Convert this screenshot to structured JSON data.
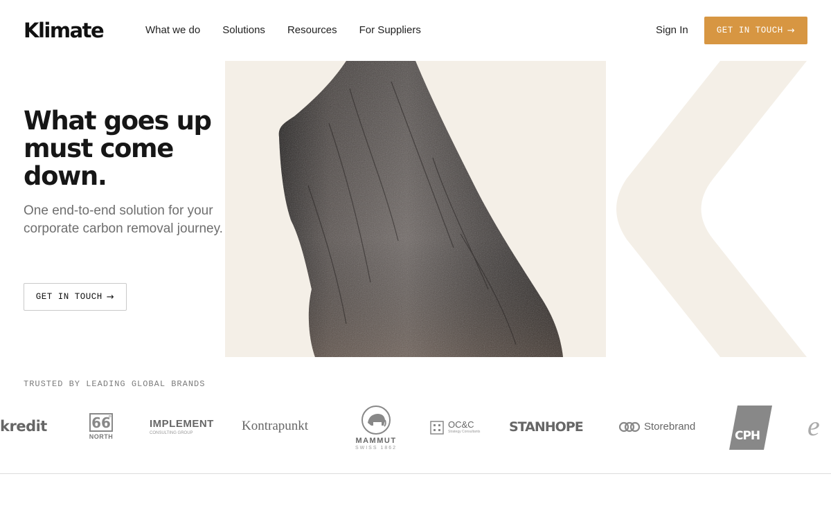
{
  "nav": {
    "logo": "Klimate",
    "links": [
      "What we do",
      "Solutions",
      "Resources",
      "For Suppliers"
    ],
    "sign_in": "Sign In",
    "cta": "GET IN TOUCH",
    "cta_arrow": "→",
    "cta_color": "#d79642"
  },
  "hero": {
    "headline": "What goes up must come down.",
    "subhead": "One end-to-end solution for your corporate carbon removal journey.",
    "cta": "GET IN TOUCH",
    "cta_arrow": "→",
    "image_icon": "charcoal-biochar-image",
    "graphic_icon": "klimate-k-chevron-icon",
    "bg_color": "#f4efe7"
  },
  "trusted": {
    "label": "TRUSTED BY LEADING GLOBAL BRANDS",
    "brands": {
      "kredit": "kredit",
      "north_num": "66",
      "north_deg": "°",
      "north_text": "NORTH",
      "implement": "IMPLEMENT",
      "implement_sub": "CONSULTING GROUP",
      "kontrapunkt": "Kontrapunkt",
      "mammut": "MAMMUT",
      "mammut_sub": "SWISS 1862",
      "occ": "OC&C",
      "occ_sub": "Strategy Consultants",
      "stanhope": "STANHOPE",
      "storebrand": "Storebrand",
      "cph": "CPH",
      "partial": "e"
    }
  }
}
